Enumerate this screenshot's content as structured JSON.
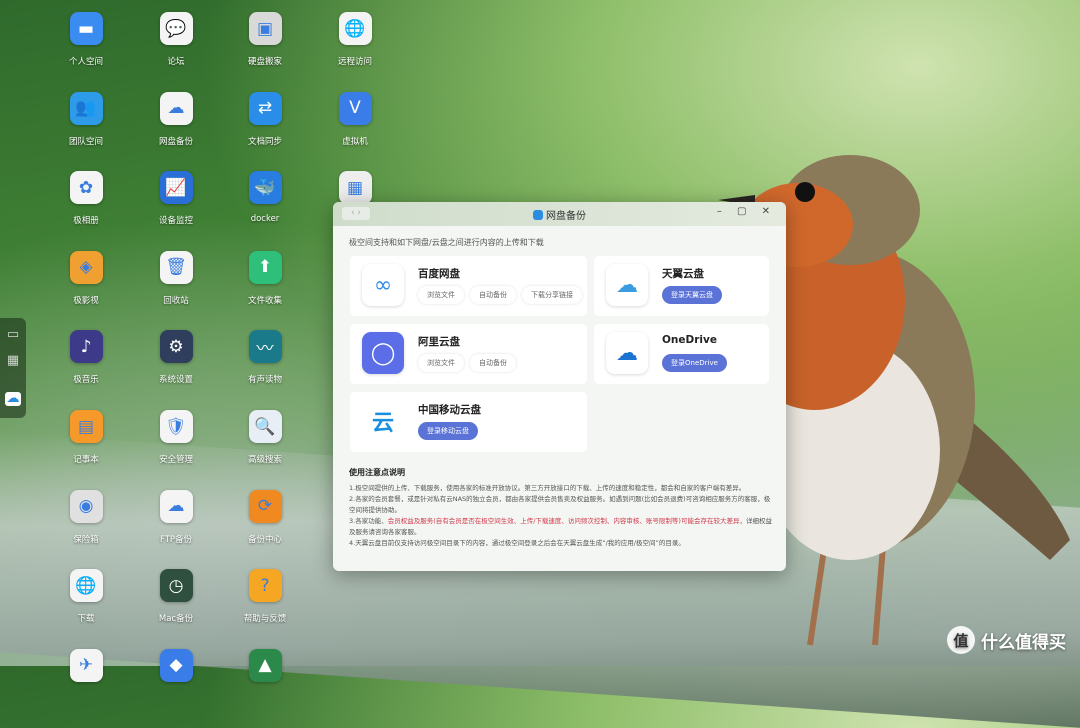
{
  "desktop": {
    "columns": [
      [
        {
          "label": "个人空间",
          "icon": "folder-icon",
          "color": "#3b8cf0",
          "glyph": "▬"
        },
        {
          "label": "团队空间",
          "icon": "team-folder-icon",
          "color": "#2d9be8",
          "glyph": "👥"
        },
        {
          "label": "极相册",
          "icon": "photos-icon",
          "color": "#f4f4f4",
          "glyph": "✿"
        },
        {
          "label": "极影视",
          "icon": "video-icon",
          "color": "#f0a030",
          "glyph": "◈"
        },
        {
          "label": "极音乐",
          "icon": "music-icon",
          "color": "#3d3a8a",
          "glyph": "♪"
        },
        {
          "label": "记事本",
          "icon": "notepad-icon",
          "color": "#f59a2a",
          "glyph": "▤"
        },
        {
          "label": "保险箱",
          "icon": "safe-icon",
          "color": "#e0e0e0",
          "glyph": "◉"
        },
        {
          "label": "下载",
          "icon": "download-globe-icon",
          "color": "#f4f4f4",
          "glyph": "🌐"
        },
        {
          "label": "",
          "icon": "plane-icon",
          "color": "#f4f4f4",
          "glyph": "✈"
        }
      ],
      [
        {
          "label": "论坛",
          "icon": "forum-icon",
          "color": "#f4f4f4",
          "glyph": "💬"
        },
        {
          "label": "网盘备份",
          "icon": "cloud-backup-icon",
          "color": "#f4f4f4",
          "glyph": "☁"
        },
        {
          "label": "设备监控",
          "icon": "monitor-icon",
          "color": "#2a6fd8",
          "glyph": "📈"
        },
        {
          "label": "回收站",
          "icon": "trash-icon",
          "color": "#f4f4f4",
          "glyph": "🗑"
        },
        {
          "label": "系统设置",
          "icon": "settings-icon",
          "color": "#2e3e5c",
          "glyph": "⚙"
        },
        {
          "label": "安全管理",
          "icon": "shield-icon",
          "color": "#f4f4f4",
          "glyph": "🛡"
        },
        {
          "label": "FTP备份",
          "icon": "ftp-icon",
          "color": "#f4f4f4",
          "glyph": "☁"
        },
        {
          "label": "Mac备份",
          "icon": "clock-icon",
          "color": "#2f4f3f",
          "glyph": "◷"
        },
        {
          "label": "",
          "icon": "app-icon",
          "color": "#3a7ce8",
          "glyph": "◆"
        }
      ],
      [
        {
          "label": "硬盘搬家",
          "icon": "disk-icon",
          "color": "#d9d9d9",
          "glyph": "▣"
        },
        {
          "label": "文档同步",
          "icon": "sync-icon",
          "color": "#2a8de8",
          "glyph": "⇄"
        },
        {
          "label": "docker",
          "icon": "docker-icon",
          "color": "#2a7de0",
          "glyph": "🐳"
        },
        {
          "label": "文件收集",
          "icon": "collect-icon",
          "color": "#2ec07a",
          "glyph": "⬆"
        },
        {
          "label": "有声读物",
          "icon": "audiobook-icon",
          "color": "#1b7a8a",
          "glyph": "〰"
        },
        {
          "label": "高级搜索",
          "icon": "search-icon",
          "color": "#e8eef6",
          "glyph": "🔍"
        },
        {
          "label": "备份中心",
          "icon": "backup-center-icon",
          "color": "#f08a20",
          "glyph": "⟳"
        },
        {
          "label": "帮助与反馈",
          "icon": "help-icon",
          "color": "#f5a623",
          "glyph": "?"
        },
        {
          "label": "",
          "icon": "app-icon",
          "color": "#2b8a4a",
          "glyph": "▲"
        }
      ],
      [
        {
          "label": "远程访问",
          "icon": "remote-icon",
          "color": "#f4f4f4",
          "glyph": "🌐"
        },
        {
          "label": "虚拟机",
          "icon": "vm-icon",
          "color": "#3a7de8",
          "glyph": "V"
        },
        {
          "label": "",
          "icon": "app-icon",
          "color": "#eeeeee",
          "glyph": "▦"
        }
      ]
    ]
  },
  "dock": {
    "items": [
      {
        "icon": "drive-icon",
        "glyph": "▭"
      },
      {
        "icon": "apps-grid-icon",
        "glyph": "▦"
      },
      {
        "icon": "cloud-backup-icon",
        "glyph": "☁"
      }
    ]
  },
  "window": {
    "title": "网盘备份",
    "nav": "‹ ›",
    "controls": "– ▢ ✕",
    "intro": "极空间支持和如下网盘/云盘之间进行内容的上传和下载",
    "services": [
      {
        "name": "百度网盘",
        "actions": [
          "浏览文件",
          "自动备份",
          "下载分享链接"
        ],
        "logo": "baidu-netdisk-icon"
      },
      {
        "name": "天翼云盘",
        "login": "登录天翼云盘",
        "logo": "tianyi-cloud-icon"
      },
      {
        "name": "阿里云盘",
        "actions": [
          "浏览文件",
          "自动备份"
        ],
        "logo": "aliyun-drive-icon"
      },
      {
        "name": "OneDrive",
        "login": "登录OneDrive",
        "logo": "onedrive-icon"
      },
      {
        "name": "中国移动云盘",
        "login": "登录移动云盘",
        "logo": "china-mobile-cloud-icon"
      }
    ],
    "notes": {
      "title": "使用注意点说明",
      "n1": "1.极空间提供的上传、下载服务，使用各家的标准开放协议。第三方开放接口的下载、上传的速度和稳定性，都会和自家的客户端有差异。",
      "n2": "2.各家的会员套餐，或是针对私有云NAS的独立会员，都由各家提供会员售卖及权益服务。如遇到问题(比如会员退费)可咨询相应服务方的客服，极空间将提供协助。",
      "n3a": "3.各家功能、",
      "n3b": "会员权益及服务(自有会员是否在极空间生效、上传/下载速度、访问频次控制、内容审核、账号限制等)可能会存在较大差异，",
      "n3c": "详细权益及服务请咨询各家客服。",
      "n4": "4.天翼云盘目前仅支持访问极空间目录下的内容，通过极空间登录之后会在天翼云盘生成“/我的应用/极空间”的目录。"
    },
    "colors": {
      "primary": "#5b72d6",
      "warning": "#d0394c"
    }
  },
  "watermark": {
    "glyph": "值",
    "text": "什么值得买"
  }
}
